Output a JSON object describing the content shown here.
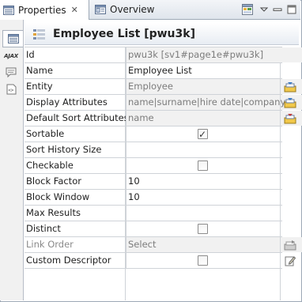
{
  "tabs": [
    {
      "label": "Properties",
      "active": true,
      "icon": "properties-icon"
    },
    {
      "label": "Overview",
      "active": false,
      "icon": "overview-icon"
    }
  ],
  "toolbar": {
    "icons": [
      "pin-view-icon",
      "view-menu-icon",
      "minimize-icon",
      "maximize-icon"
    ]
  },
  "side_tabs": [
    {
      "icon": "general-tab-icon",
      "selected": true
    },
    {
      "icon": "ajax-tab-icon",
      "selected": false,
      "text": "AJAX"
    },
    {
      "icon": "comment-tab-icon",
      "selected": false
    },
    {
      "icon": "source-tab-icon",
      "selected": false
    }
  ],
  "header": {
    "title": "Employee List [pwu3k]",
    "icon": "list-icon"
  },
  "rows": [
    {
      "name": "Id",
      "value": "pwu3k  [sv1#page1e#pwu3k]",
      "readonly": true,
      "name_dim": false,
      "action": ""
    },
    {
      "name": "Name",
      "value": "Employee List",
      "readonly": false,
      "name_dim": false,
      "action": ""
    },
    {
      "name": "Entity",
      "value": "Employee",
      "readonly": true,
      "name_dim": false,
      "action": "entity-picker-icon"
    },
    {
      "name": "Display Attributes",
      "value": "name|surname|hire date|company",
      "readonly": true,
      "name_dim": false,
      "action": "attribute-picker-icon"
    },
    {
      "name": "Default Sort Attributes",
      "value": "name",
      "readonly": true,
      "name_dim": false,
      "action": "sort-picker-icon"
    },
    {
      "name": "Sortable",
      "value": "",
      "checkbox": true,
      "checked": true,
      "readonly": false,
      "name_dim": false,
      "action": ""
    },
    {
      "name": "Sort History Size",
      "value": "",
      "readonly": false,
      "name_dim": false,
      "action": ""
    },
    {
      "name": "Checkable",
      "value": "",
      "checkbox": true,
      "checked": false,
      "readonly": false,
      "name_dim": false,
      "action": ""
    },
    {
      "name": "Block Factor",
      "value": "10",
      "readonly": false,
      "name_dim": false,
      "action": ""
    },
    {
      "name": "Block Window",
      "value": "10",
      "readonly": false,
      "name_dim": false,
      "action": ""
    },
    {
      "name": "Max Results",
      "value": "",
      "readonly": false,
      "name_dim": false,
      "action": ""
    },
    {
      "name": "Distinct",
      "value": "",
      "checkbox": true,
      "checked": false,
      "readonly": false,
      "name_dim": false,
      "action": ""
    },
    {
      "name": "Link Order",
      "value": "Select",
      "readonly": true,
      "name_dim": true,
      "action": "link-order-icon"
    },
    {
      "name": "Custom Descriptor",
      "value": "",
      "checkbox": true,
      "checked": false,
      "readonly": false,
      "name_dim": false,
      "action": "edit-descriptor-icon"
    }
  ]
}
